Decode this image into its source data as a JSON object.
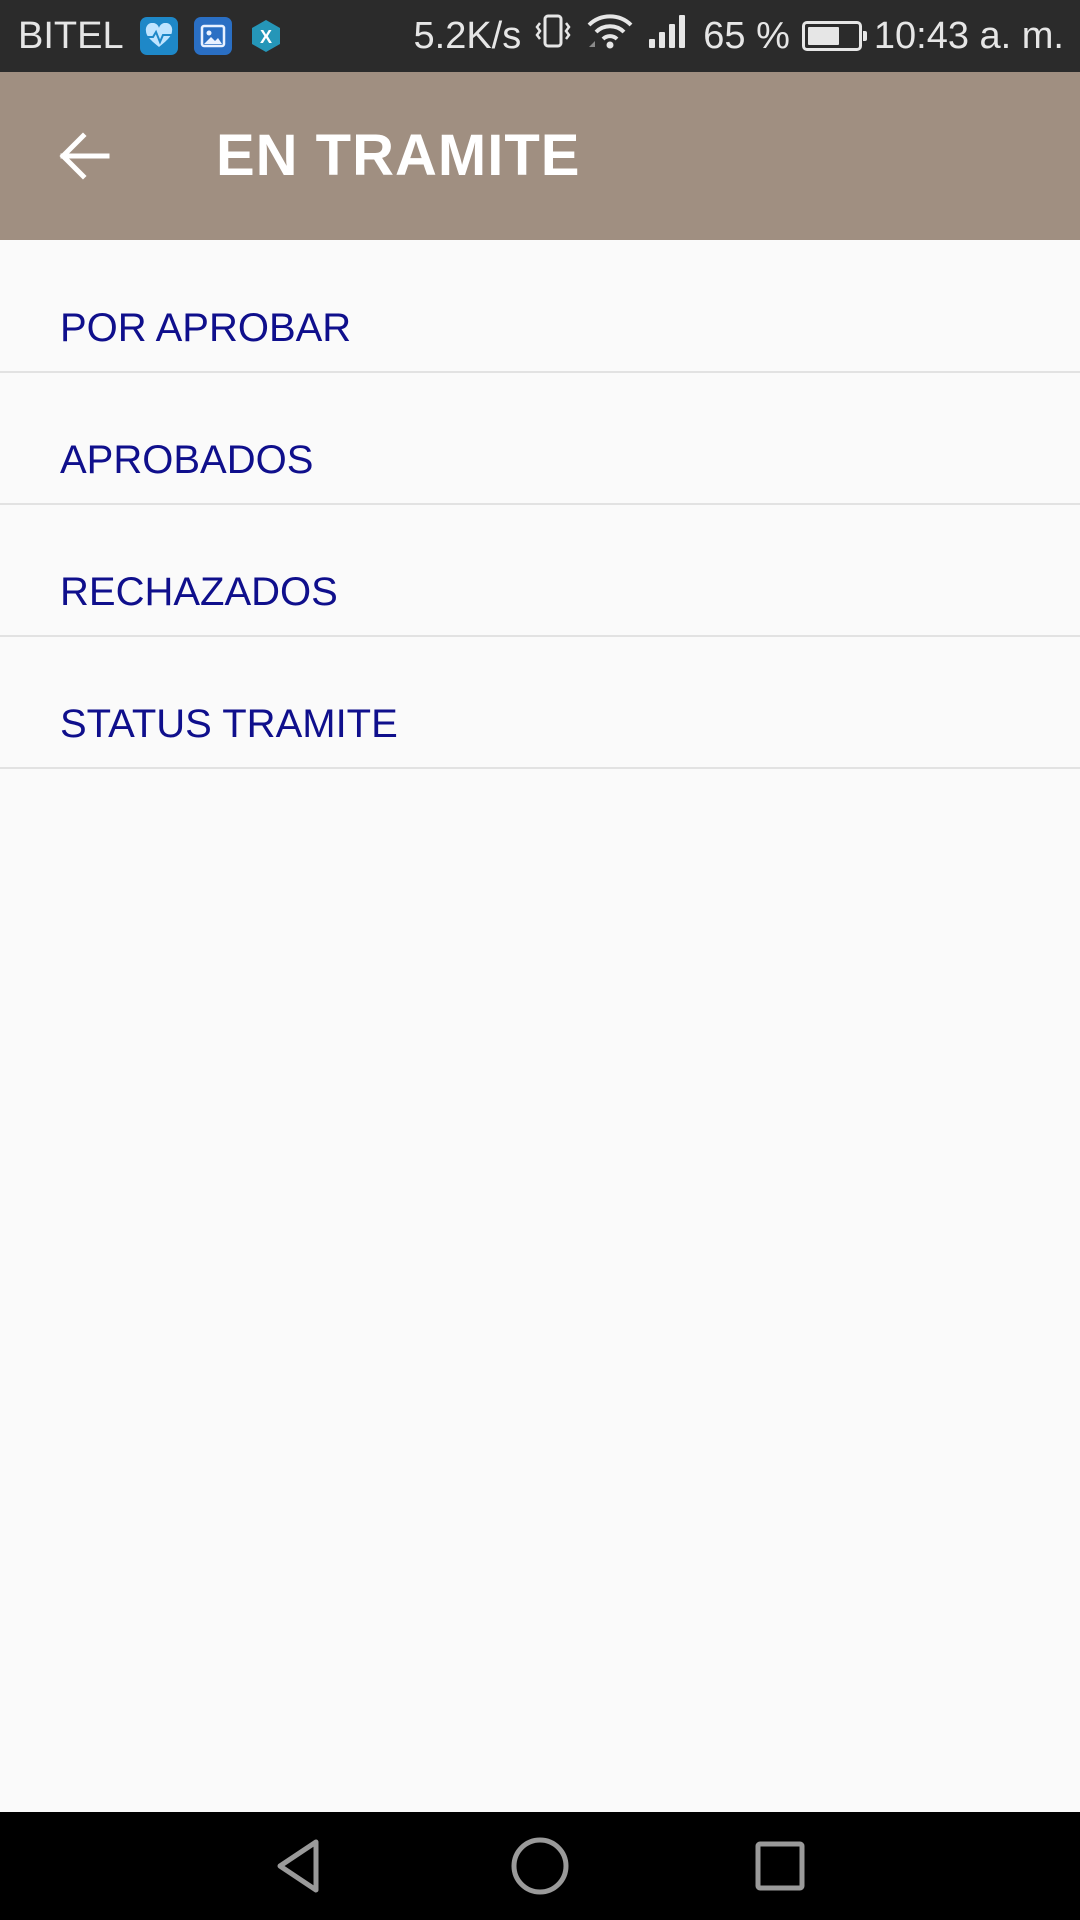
{
  "status_bar": {
    "carrier": "BITEL",
    "net_speed": "5.2K/s",
    "battery_percent": "65 %",
    "battery_level": 0.65,
    "time": "10:43 a. m.",
    "notification_icons": [
      "health-icon",
      "gallery-icon",
      "x-app-icon"
    ],
    "system_icons": [
      "vibrate-icon",
      "wifi-icon",
      "signal-icon",
      "battery-icon"
    ]
  },
  "app_bar": {
    "title": "EN TRAMITE",
    "background_color": "#a08f81",
    "back_icon": "arrow-back-icon"
  },
  "menu": {
    "items": [
      {
        "label": "POR APROBAR"
      },
      {
        "label": "APROBADOS"
      },
      {
        "label": "RECHAZADOS"
      },
      {
        "label": "STATUS TRAMITE"
      }
    ],
    "text_color": "#0f0f8c"
  },
  "nav_bar": {
    "buttons": [
      "back-triangle-icon",
      "home-circle-icon",
      "recents-square-icon"
    ]
  }
}
